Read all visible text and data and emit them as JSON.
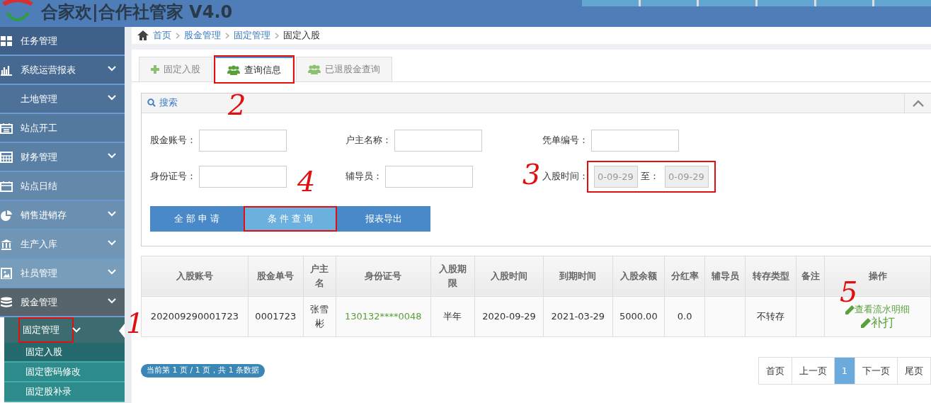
{
  "header": {
    "title": "合家欢|合作社管家 V4.0"
  },
  "sidebar": {
    "items": [
      {
        "label": "任务管理"
      },
      {
        "label": "系统运营报表",
        "expanded": false
      },
      {
        "label": "土地管理",
        "expanded": false
      },
      {
        "label": "站点开工"
      },
      {
        "label": "财务管理",
        "expanded": false
      },
      {
        "label": "站点日结"
      },
      {
        "label": "销售进销存",
        "expanded": false
      },
      {
        "label": "生产入库",
        "expanded": false
      },
      {
        "label": "社员管理",
        "expanded": false
      },
      {
        "label": "股金管理",
        "expanded": true,
        "children": [
          {
            "label": "固定管理",
            "expanded": true,
            "highlighted": true,
            "children": [
              {
                "label": "固定入股",
                "selected": true
              },
              {
                "label": "固定密码修改",
                "selected": false
              },
              {
                "label": "固定股补录",
                "selected": false
              }
            ]
          }
        ]
      }
    ]
  },
  "breadcrumb": [
    "首页",
    "股金管理",
    "固定管理",
    "固定入股"
  ],
  "tabs": [
    {
      "label": "固定入股",
      "selected": false,
      "highlighted": false,
      "kind": "plus"
    },
    {
      "label": "查询信息",
      "selected": true,
      "highlighted": true,
      "kind": "users"
    },
    {
      "label": "已退股金查询",
      "selected": false,
      "highlighted": false,
      "kind": "users"
    }
  ],
  "search": {
    "title": "搜索",
    "fields": [
      {
        "label": "股金账号："
      },
      {
        "label": "户主名称："
      },
      {
        "label": "凭单编号："
      },
      {
        "label": "身份证号："
      },
      {
        "label": "辅导员："
      }
    ],
    "date_range": {
      "label": "入股时间：",
      "from": "0-09-29",
      "separator": "至：",
      "to": "0-09-29",
      "highlighted": true
    },
    "buttons": [
      {
        "label": "全 部 申 请",
        "highlighted": false,
        "selected": false
      },
      {
        "label": "条 件 查 询",
        "highlighted": true,
        "selected": true
      },
      {
        "label": "报表导出",
        "highlighted": false,
        "selected": false
      }
    ]
  },
  "table": {
    "columns": [
      "入股账号",
      "股金单号",
      "户主名",
      "身份证号",
      "入股期限",
      "入股时间",
      "到期时间",
      "入股余额",
      "分红率",
      "辅导员",
      "转存类型",
      "备注",
      "操作"
    ],
    "rows": [
      {
        "cells": [
          "202009290001723",
          "0001723",
          "张雪彬",
          "130132****0048",
          "半年",
          "2020-09-29",
          "2021-03-29",
          "5000.00",
          "0.0",
          "",
          "不转存",
          ""
        ],
        "actions": [
          "查看流水明细",
          "补打"
        ]
      }
    ]
  },
  "pagination": {
    "summary": "当前第 1 页 / 1 页，共 1 条数据",
    "pages": [
      {
        "label": "首页",
        "selected": false
      },
      {
        "label": "上一页",
        "selected": false
      },
      {
        "label": "1",
        "selected": true
      },
      {
        "label": "下一页",
        "selected": false
      },
      {
        "label": "尾页",
        "selected": false
      }
    ]
  },
  "annotations": [
    {
      "label": "1"
    },
    {
      "label": "2"
    },
    {
      "label": "3"
    },
    {
      "label": "4"
    },
    {
      "label": "5"
    }
  ]
}
